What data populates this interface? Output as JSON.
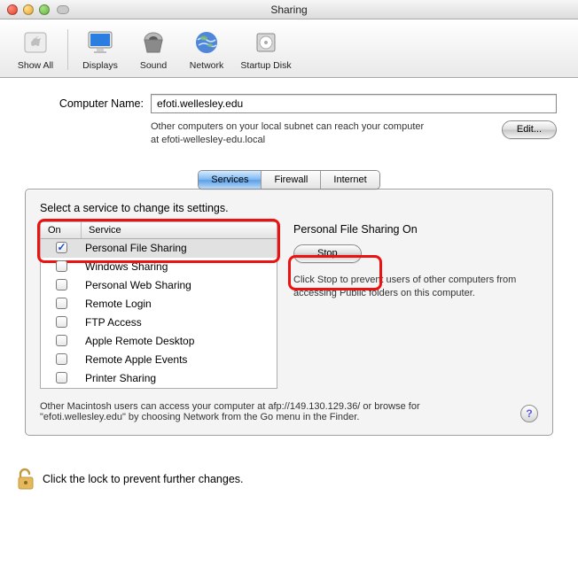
{
  "window": {
    "title": "Sharing"
  },
  "toolbar": {
    "items": [
      {
        "label": "Show All"
      },
      {
        "label": "Displays"
      },
      {
        "label": "Sound"
      },
      {
        "label": "Network"
      },
      {
        "label": "Startup Disk"
      }
    ]
  },
  "computer_name": {
    "label": "Computer Name:",
    "value": "efoti.wellesley.edu",
    "hint": "Other computers on your local subnet can reach your computer at efoti-wellesley-edu.local",
    "edit_label": "Edit..."
  },
  "tabs": {
    "items": [
      {
        "label": "Services",
        "selected": true
      },
      {
        "label": "Firewall",
        "selected": false
      },
      {
        "label": "Internet",
        "selected": false
      }
    ]
  },
  "services": {
    "prompt": "Select a service to change its settings.",
    "col_on": "On",
    "col_service": "Service",
    "rows": [
      {
        "name": "Personal File Sharing",
        "on": true,
        "selected": true
      },
      {
        "name": "Windows Sharing",
        "on": false
      },
      {
        "name": "Personal Web Sharing",
        "on": false
      },
      {
        "name": "Remote Login",
        "on": false
      },
      {
        "name": "FTP Access",
        "on": false
      },
      {
        "name": "Apple Remote Desktop",
        "on": false
      },
      {
        "name": "Remote Apple Events",
        "on": false
      },
      {
        "name": "Printer Sharing",
        "on": false
      }
    ]
  },
  "detail": {
    "heading": "Personal File Sharing On",
    "button": "Stop",
    "desc": "Click Stop to prevent users of other computers from accessing Public folders on this computer."
  },
  "footer": "Other Macintosh users can access your computer at afp://149.130.129.36/ or browse for \"efoti.wellesley.edu\" by choosing Network from the Go menu in the Finder.",
  "help": "?",
  "lock": "Click the lock to prevent further changes."
}
